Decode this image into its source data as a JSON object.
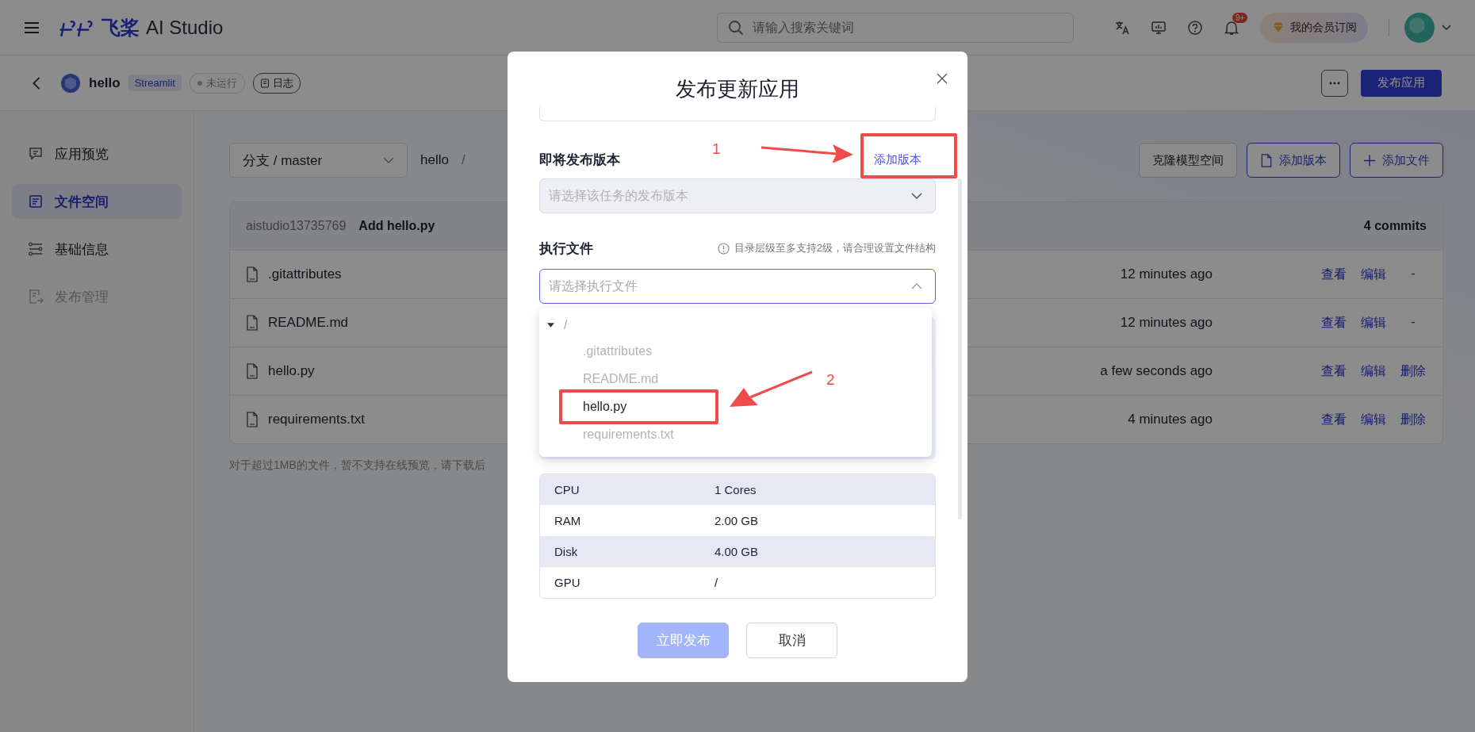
{
  "topbar": {
    "logo_cn": "飞桨",
    "logo_en": "AI Studio",
    "search": {
      "placeholder": "请输入搜索关键词"
    },
    "notification_badge": "9+",
    "member_button": "我的会员订阅"
  },
  "app_bar": {
    "name": "hello",
    "framework_tag": "Streamlit",
    "status": "未运行",
    "log_button": "日志",
    "publish_button": "发布应用"
  },
  "sidebar": {
    "items": [
      {
        "label": "应用预览",
        "selected": false,
        "disabled": false
      },
      {
        "label": "文件空间",
        "selected": true,
        "disabled": false
      },
      {
        "label": "基础信息",
        "selected": false,
        "disabled": false
      },
      {
        "label": "发布管理",
        "selected": false,
        "disabled": true
      }
    ]
  },
  "files": {
    "branch": "分支 / master",
    "path": "hello",
    "path_sep": "/",
    "buttons": [
      {
        "label": "克隆模型空间",
        "kind": "plain"
      },
      {
        "label": "添加版本",
        "kind": "file"
      },
      {
        "label": "添加文件",
        "kind": "plus"
      }
    ],
    "commit": {
      "author": "aistudio13735769",
      "message": "Add hello.py",
      "count": "4 commits"
    },
    "rows": [
      {
        "name": ".gitattributes",
        "time": "12 minutes ago",
        "actions": [
          "查看",
          "编辑",
          "-"
        ]
      },
      {
        "name": "README.md",
        "time": "12 minutes ago",
        "actions": [
          "查看",
          "编辑",
          "-"
        ]
      },
      {
        "name": "hello.py",
        "time": "a few seconds ago",
        "actions": [
          "查看",
          "编辑",
          "删除"
        ]
      },
      {
        "name": "requirements.txt",
        "time": "4 minutes ago",
        "actions": [
          "查看",
          "编辑",
          "删除"
        ]
      }
    ],
    "note": "对于超过1MB的文件，暂不支持在线预览，请下载后"
  },
  "dialog": {
    "title": "发布更新应用",
    "version": {
      "label": "即将发布版本",
      "link": "添加版本",
      "select": {
        "placeholder": "请选择该任务的发布版本",
        "disabled": true
      }
    },
    "exec_file": {
      "label": "执行文件",
      "hint": "目录层级至多支持2级，请合理设置文件结构",
      "select": {
        "placeholder": "请选择执行文件",
        "expanded": true
      },
      "tree": {
        "label": "/",
        "expanded": true,
        "children": [
          {
            "label": ".gitattributes",
            "disabled": true
          },
          {
            "label": "README.md",
            "disabled": true
          },
          {
            "label": "hello.py",
            "disabled": false
          },
          {
            "label": "requirements.txt",
            "disabled": true
          }
        ]
      }
    },
    "specs": [
      {
        "name": "CPU",
        "value": "1 Cores"
      },
      {
        "name": "RAM",
        "value": "2.00 GB"
      },
      {
        "name": "Disk",
        "value": "4.00 GB"
      },
      {
        "name": "GPU",
        "value": "/"
      }
    ],
    "buttons": [
      {
        "label": "立即发布",
        "kind": "primary",
        "disabled": true
      },
      {
        "label": "取消",
        "kind": "default",
        "disabled": false
      }
    ]
  },
  "annotations": [
    {
      "label": "1"
    },
    {
      "label": "2"
    }
  ]
}
